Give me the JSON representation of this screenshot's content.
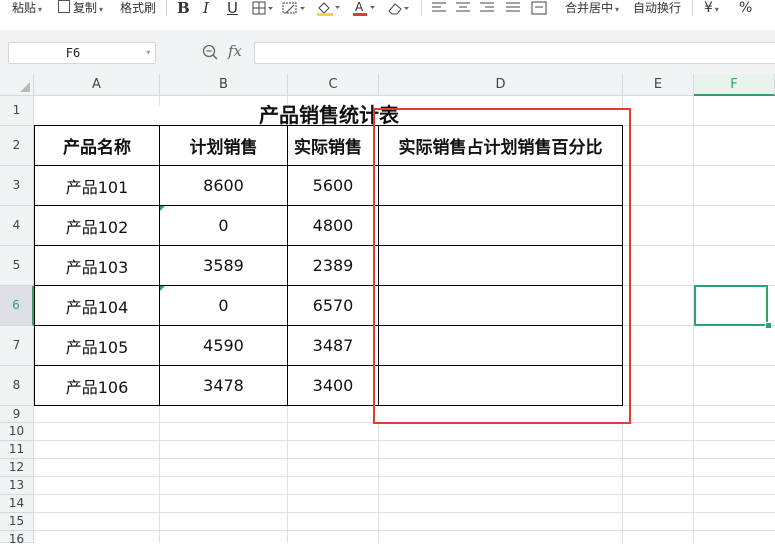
{
  "toolbar": {
    "paste": "粘贴",
    "copy": "复制",
    "format_painter": "格式刷",
    "merge_center": "合并居中",
    "wrap_text": "自动换行",
    "currency": "¥",
    "percent": "%"
  },
  "formula_bar": {
    "name_box": "F6",
    "fx": "fx",
    "formula": ""
  },
  "columns": [
    "A",
    "B",
    "C",
    "D",
    "E",
    "F"
  ],
  "active_column": "F",
  "rows": [
    "1",
    "2",
    "3",
    "4",
    "5",
    "6",
    "7",
    "8",
    "9",
    "10",
    "11",
    "12",
    "13",
    "14",
    "15",
    "16"
  ],
  "active_row": "6",
  "sheet": {
    "title": "产品销售统计表",
    "headers": [
      "产品名称",
      "计划销售",
      "实际销售",
      "实际销售占计划销售百分比"
    ],
    "data": [
      [
        "产品101",
        "8600",
        "5600",
        ""
      ],
      [
        "产品102",
        "0",
        "4800",
        ""
      ],
      [
        "产品103",
        "3589",
        "2389",
        ""
      ],
      [
        "产品104",
        "0",
        "6570",
        ""
      ],
      [
        "产品105",
        "4590",
        "3487",
        ""
      ],
      [
        "产品106",
        "3478",
        "3400",
        ""
      ]
    ]
  },
  "colors": {
    "highlight_box": "#e53935",
    "selection": "#2aa36e",
    "header_bg": "#f2f3f5"
  }
}
